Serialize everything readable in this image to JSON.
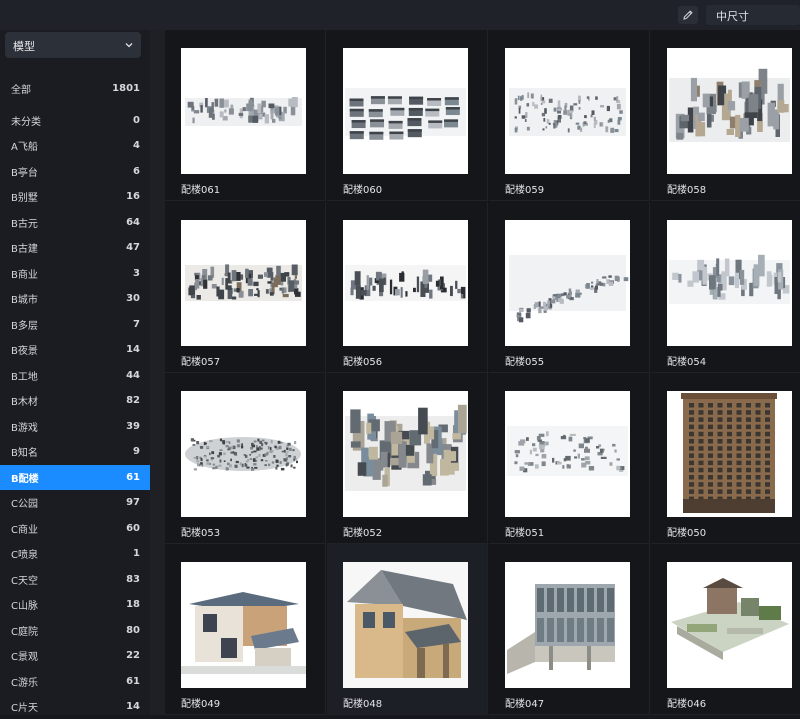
{
  "topbar": {
    "size_value": "中尺寸",
    "edit_icon": "pencil-icon"
  },
  "sidebar": {
    "category": "模型",
    "items": [
      {
        "label": "全部",
        "count": "1801"
      },
      {
        "label": "未分类",
        "count": "0"
      },
      {
        "label": "A飞船",
        "count": "4"
      },
      {
        "label": "B亭台",
        "count": "6"
      },
      {
        "label": "B别墅",
        "count": "16"
      },
      {
        "label": "B古元",
        "count": "64"
      },
      {
        "label": "B古建",
        "count": "47"
      },
      {
        "label": "B商业",
        "count": "3"
      },
      {
        "label": "B城市",
        "count": "30"
      },
      {
        "label": "B多层",
        "count": "7"
      },
      {
        "label": "B夜景",
        "count": "14"
      },
      {
        "label": "B工地",
        "count": "44"
      },
      {
        "label": "B木材",
        "count": "82"
      },
      {
        "label": "B游戏",
        "count": "39"
      },
      {
        "label": "B知名",
        "count": "9"
      },
      {
        "label": "B配楼",
        "count": "61"
      },
      {
        "label": "C公园",
        "count": "97"
      },
      {
        "label": "C商业",
        "count": "60"
      },
      {
        "label": "C喷泉",
        "count": "1"
      },
      {
        "label": "C天空",
        "count": "83"
      },
      {
        "label": "C山脉",
        "count": "18"
      },
      {
        "label": "C庭院",
        "count": "80"
      },
      {
        "label": "C景观",
        "count": "22"
      },
      {
        "label": "C游乐",
        "count": "61"
      },
      {
        "label": "C片天",
        "count": "14"
      }
    ],
    "active_index": 15
  },
  "grid": {
    "items": [
      {
        "name": "配楼061",
        "kind": "citystrip"
      },
      {
        "name": "配楼060",
        "kind": "blocks"
      },
      {
        "name": "配楼059",
        "kind": "scatter"
      },
      {
        "name": "配楼058",
        "kind": "city3d"
      },
      {
        "name": "配楼057",
        "kind": "citystrip-dark"
      },
      {
        "name": "配楼056",
        "kind": "row"
      },
      {
        "name": "配楼055",
        "kind": "scatter-diag"
      },
      {
        "name": "配楼054",
        "kind": "row-grey"
      },
      {
        "name": "配楼053",
        "kind": "disc"
      },
      {
        "name": "配楼052",
        "kind": "city3d-big"
      },
      {
        "name": "配楼051",
        "kind": "scatter-low"
      },
      {
        "name": "配楼050",
        "kind": "tower"
      },
      {
        "name": "配楼049",
        "kind": "villa"
      },
      {
        "name": "配楼048",
        "kind": "house"
      },
      {
        "name": "配楼047",
        "kind": "glass-building"
      },
      {
        "name": "配楼046",
        "kind": "courtyard"
      }
    ]
  }
}
